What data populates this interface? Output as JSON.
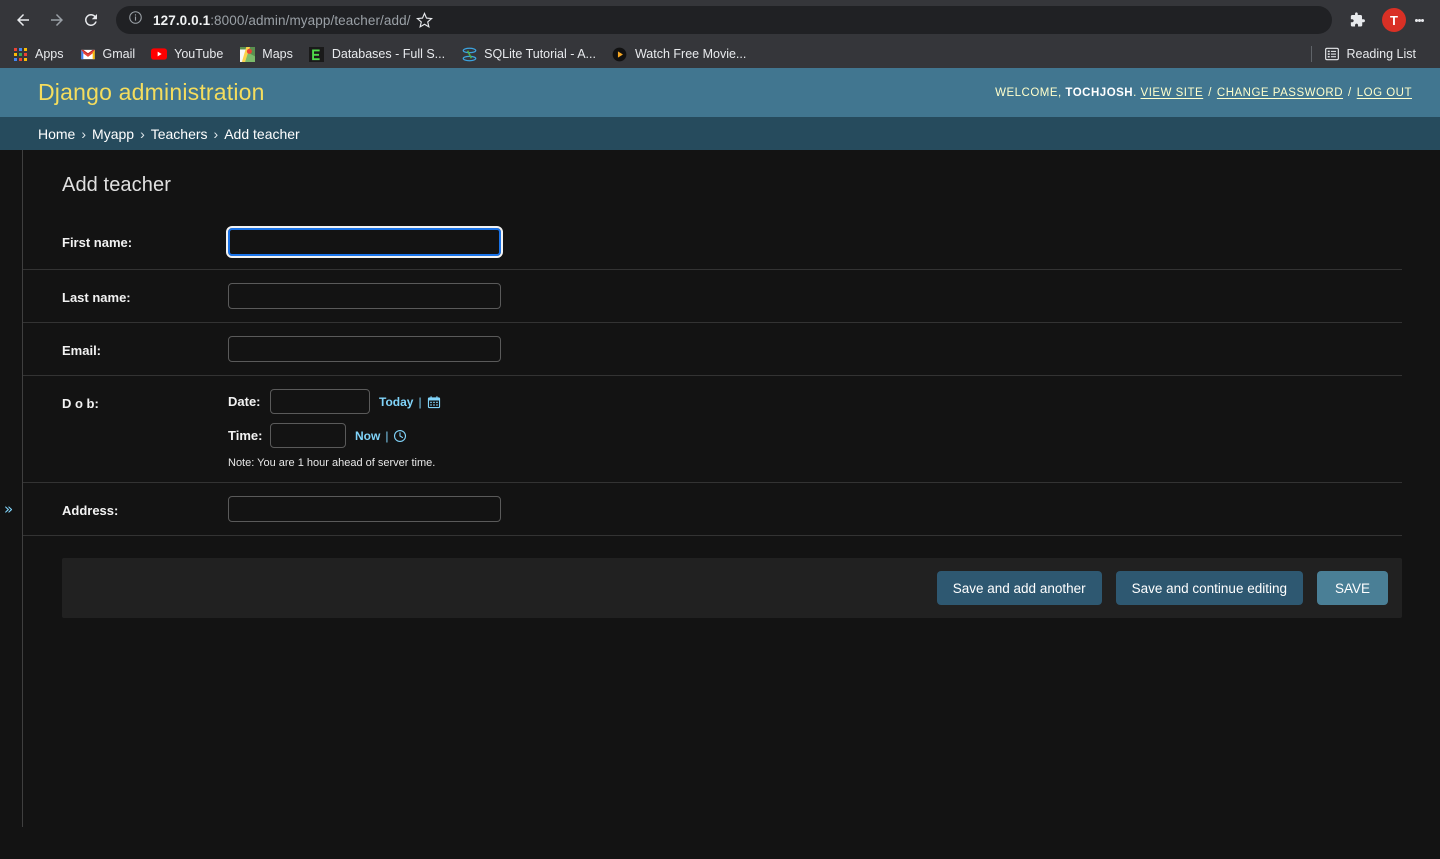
{
  "browser": {
    "back_icon": "back-arrow-icon",
    "forward_icon": "forward-arrow-icon",
    "reload_icon": "reload-icon",
    "site_info_icon": "site-info-icon",
    "url_host": "127.0.0.1",
    "url_path": ":8000/admin/myapp/teacher/add/",
    "url_full": "127.0.0.1:8000/admin/myapp/teacher/add/",
    "bookmark_star_icon": "star-icon",
    "extensions_icon": "puzzle-piece-icon",
    "profile_initial": "T",
    "menu_icon": "three-dot-menu-icon",
    "bookmarks": [
      {
        "label": "Apps",
        "icon": "apps-grid-icon"
      },
      {
        "label": "Gmail",
        "icon": "gmail-icon"
      },
      {
        "label": "YouTube",
        "icon": "youtube-icon"
      },
      {
        "label": "Maps",
        "icon": "google-maps-icon"
      },
      {
        "label": "Databases - Full S...",
        "icon": "databases-favicon"
      },
      {
        "label": "SQLite Tutorial - A...",
        "icon": "sqlite-icon"
      },
      {
        "label": "Watch Free Movie...",
        "icon": "play-circle-icon"
      }
    ],
    "reading_list": {
      "label": "Reading List",
      "icon": "reading-list-icon"
    }
  },
  "admin": {
    "branding": "Django administration",
    "user_tools": {
      "welcome_prefix": "WELCOME,",
      "username": "TOCHJOSH",
      "period": ".",
      "view_site": "VIEW SITE",
      "change_password": "CHANGE PASSWORD",
      "log_out": "LOG OUT",
      "separator": "/"
    },
    "breadcrumbs": [
      {
        "label": "Home"
      },
      {
        "label": "Myapp"
      },
      {
        "label": "Teachers"
      },
      {
        "label": "Add teacher"
      }
    ],
    "breadcrumb_separator": "›",
    "page_title": "Add teacher",
    "sidebar_toggle_icon": "double-chevron-right-icon",
    "form": {
      "fields": [
        {
          "label": "First name:",
          "value": "",
          "focused": true
        },
        {
          "label": "Last name:",
          "value": "",
          "focused": false
        },
        {
          "label": "Email:",
          "value": "",
          "focused": false
        }
      ],
      "dob": {
        "label": "D o b:",
        "date_label": "Date:",
        "date_value": "",
        "today_link": "Today",
        "calendar_icon": "calendar-icon",
        "time_label": "Time:",
        "time_value": "",
        "now_link": "Now",
        "clock_icon": "clock-icon",
        "pipe": "|",
        "note": "Note: You are 1 hour ahead of server time."
      },
      "address": {
        "label": "Address:",
        "value": ""
      }
    },
    "submit_row": {
      "save_add_another": "Save and add another",
      "save_continue": "Save and continue editing",
      "save": "SAVE"
    },
    "colors": {
      "header_bg": "#417690",
      "breadcrumb_bg": "#264b5d",
      "branding_text": "#f5dd5d",
      "page_bg": "#131313",
      "link": "#81d4fa",
      "button_bg": "#2e5871",
      "default_button_bg": "#4a7f96",
      "focus_ring": "#1a73e8"
    }
  }
}
